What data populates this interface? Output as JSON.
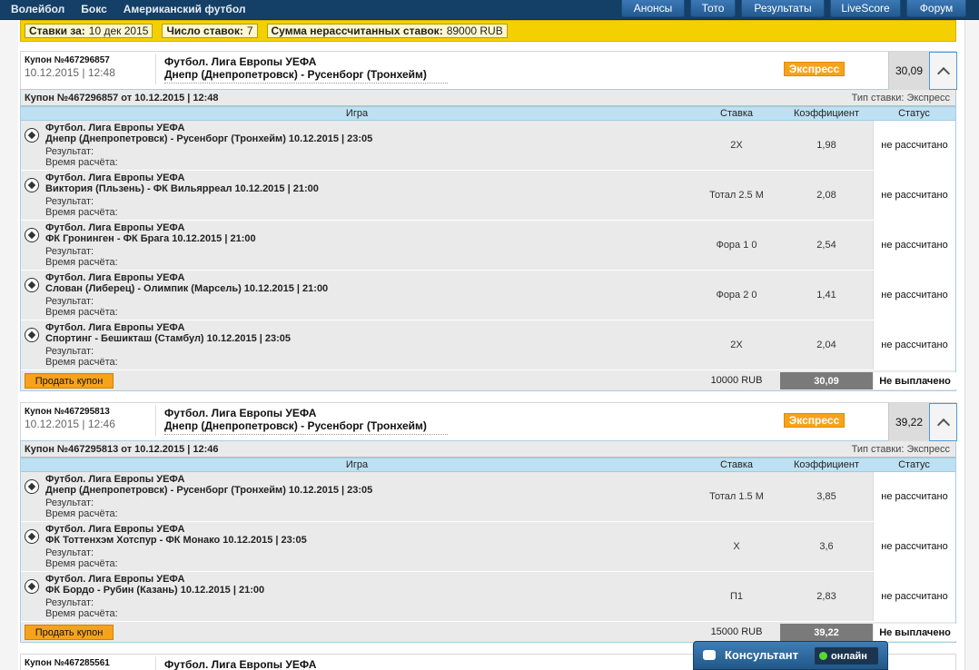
{
  "topnav": {
    "left_items": [
      "Волейбол",
      "Бокс",
      "Американский футбол"
    ],
    "right_buttons": [
      "Анонсы",
      "Тото",
      "Результаты",
      "LiveScore",
      "Форум"
    ]
  },
  "infobar": {
    "bets_for_label": "Ставки за:",
    "bets_for_value": "10 дек 2015",
    "count_label": "Число ставок:",
    "count_value": "7",
    "sum_label": "Сумма нерассчитанных ставок:",
    "sum_value": "89000 RUB"
  },
  "coupons": [
    {
      "number": "Купон №467296857",
      "date": "10.12.2015 | 12:48",
      "league": "Футбол. Лига Европы УЕФА",
      "teams": "Днепр (Днепропетровск) - Русенборг (Тронхейм)",
      "badge": "Экспресс",
      "coef": "30,09",
      "sub_title": "Купон №467296857 от 10.12.2015 | 12:48",
      "bet_type": "Тип ставки: Экспресс",
      "headers": {
        "game": "Игра",
        "stake": "Ставка",
        "coef": "Коэффициент",
        "status": "Статус"
      },
      "rows": [
        {
          "league": "Футбол. Лига Европы УЕФА",
          "match": "Днепр (Днепропетровск) - Русенборг (Тронхейм) 10.12.2015 | 23:05",
          "result": "Результат:",
          "calc": "Время расчёта:",
          "stake": "2X",
          "coef": "1,98",
          "status": "не рассчитано"
        },
        {
          "league": "Футбол. Лига Европы УЕФА",
          "match": "Виктория (Пльзень) - ФК Вильярреал 10.12.2015 | 21:00",
          "result": "Результат:",
          "calc": "Время расчёта:",
          "stake": "Тотал 2.5 М",
          "coef": "2,08",
          "status": "не рассчитано"
        },
        {
          "league": "Футбол. Лига Европы УЕФА",
          "match": "ФК Гронинген - ФК Брага 10.12.2015 | 21:00",
          "result": "Результат:",
          "calc": "Время расчёта:",
          "stake": "Фора 1 0",
          "coef": "2,54",
          "status": "не рассчитано"
        },
        {
          "league": "Футбол. Лига Европы УЕФА",
          "match": "Слован (Либерец) - Олимпик (Марсель) 10.12.2015 | 21:00",
          "result": "Результат:",
          "calc": "Время расчёта:",
          "stake": "Фора 2 0",
          "coef": "1,41",
          "status": "не рассчитано"
        },
        {
          "league": "Футбол. Лига Европы УЕФА",
          "match": "Спортинг - Бешикташ (Стамбул) 10.12.2015 | 23:05",
          "result": "Результат:",
          "calc": "Время расчёта:",
          "stake": "2X",
          "coef": "2,04",
          "status": "не рассчитано"
        }
      ],
      "sell_label": "Продать купон",
      "total_stake": "10000 RUB",
      "total_coef": "30,09",
      "payout_status": "Не выплачено"
    },
    {
      "number": "Купон №467295813",
      "date": "10.12.2015 | 12:46",
      "league": "Футбол. Лига Европы УЕФА",
      "teams": "Днепр (Днепропетровск) - Русенборг (Тронхейм)",
      "badge": "Экспресс",
      "coef": "39,22",
      "sub_title": "Купон №467295813 от 10.12.2015 | 12:46",
      "bet_type": "Тип ставки: Экспресс",
      "headers": {
        "game": "Игра",
        "stake": "Ставка",
        "coef": "Коэффициент",
        "status": "Статус"
      },
      "rows": [
        {
          "league": "Футбол. Лига Европы УЕФА",
          "match": "Днепр (Днепропетровск) - Русенборг (Тронхейм) 10.12.2015 | 23:05",
          "result": "Результат:",
          "calc": "Время расчёта:",
          "stake": "Тотал 1.5 М",
          "coef": "3,85",
          "status": "не рассчитано"
        },
        {
          "league": "Футбол. Лига Европы УЕФА",
          "match": "ФК Тоттенхэм Хотспур - ФК Монако 10.12.2015 | 23:05",
          "result": "Результат:",
          "calc": "Время расчёта:",
          "stake": "X",
          "coef": "3,6",
          "status": "не рассчитано"
        },
        {
          "league": "Футбол. Лига Европы УЕФА",
          "match": "ФК Бордо - Рубин (Казань) 10.12.2015 | 21:00",
          "result": "Результат:",
          "calc": "Время расчёта:",
          "stake": "П1",
          "coef": "2,83",
          "status": "не рассчитано"
        }
      ],
      "sell_label": "Продать купон",
      "total_stake": "15000 RUB",
      "total_coef": "39,22",
      "payout_status": "Не выплачено"
    },
    {
      "number": "Купон №467285561",
      "league": "Футбол. Лига Европы УЕФА"
    }
  ],
  "consultant": {
    "label": "Консультант",
    "status": "онлайн"
  }
}
